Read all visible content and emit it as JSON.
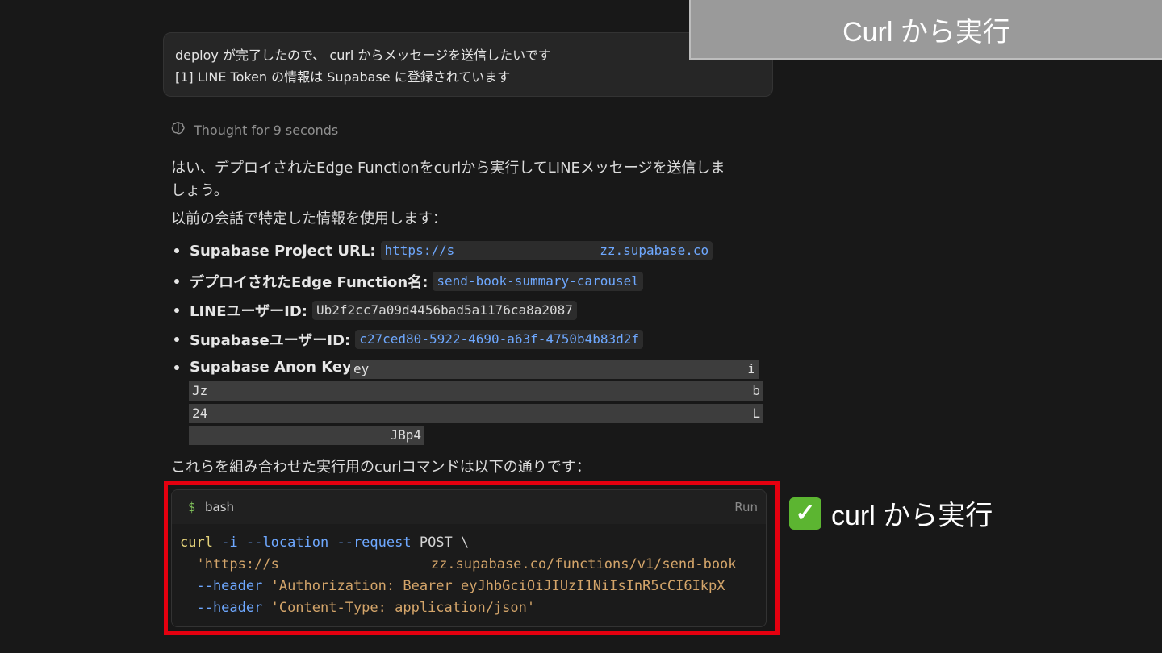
{
  "banner": {
    "title": "Curl から実行"
  },
  "user_message": {
    "line1": "deploy が完了したので、 curl からメッセージを送信したいです",
    "line2": "[1] LINE Token の情報は Supabase に登録されています"
  },
  "thought": {
    "label": "Thought for 9 seconds"
  },
  "response": {
    "intro_line1": "はい、デプロイされたEdge Functionをcurlから実行してLINEメッセージを送信しま",
    "intro_line2": "しょう。",
    "para2": "以前の会話で特定した情報を使用します：",
    "bullets": [
      {
        "label": "Supabase Project URL:",
        "value_start": "https://s",
        "value_end": "zz.supabase.co"
      },
      {
        "label": "デプロイされたEdge Function名:",
        "value": "send-book-summary-carousel"
      },
      {
        "label": "LINEユーザーID:",
        "value": "Ub2f2cc7a09d4456bad5a1176ca8a2087"
      },
      {
        "label": "SupabaseユーザーID:",
        "value": "c27ced80-5922-4690-a63f-4750b4b83d2f"
      },
      {
        "label": "Supabase Anon Key:",
        "key_lines": [
          {
            "start": "ey",
            "end": "i"
          },
          {
            "start": "Jz",
            "end": "b"
          },
          {
            "start": "24",
            "end": "L"
          },
          {
            "start": "",
            "end": "JBp4"
          }
        ]
      }
    ],
    "para3": "これらを組み合わせた実行用のcurlコマンドは以下の通りです："
  },
  "code_block": {
    "language": "bash",
    "prompt_symbol": "$",
    "run_label": "Run",
    "lines": {
      "l1_cmd": "curl",
      "l1_flags": " -i --location --request",
      "l1_rest": " POST \\",
      "l2_a": "  'https://s",
      "l2_b": "zz.supabase.co/functions/v1/send-book",
      "l3_flag": "  --header",
      "l3_str": " 'Authorization: Bearer eyJhbGciOiJIUzI1NiIsInR5cCI6IkpX",
      "l4_flag": "  --header",
      "l4_str": " 'Content-Type: application/json'"
    }
  },
  "callout": {
    "icon": "check-mark-icon",
    "label": "curl から実行"
  },
  "colors": {
    "highlight_frame": "#e4000f",
    "banner_bg": "#9a9a9a",
    "check_green": "#5cb531"
  }
}
